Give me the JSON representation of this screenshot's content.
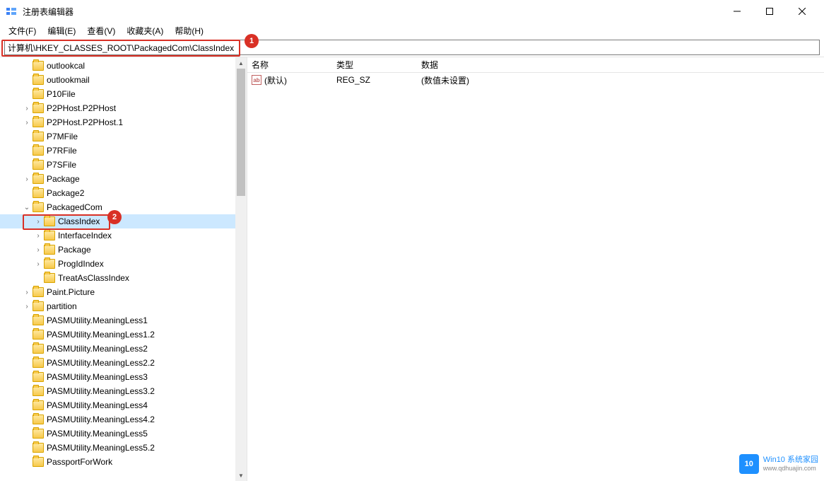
{
  "window": {
    "title": "注册表编辑器"
  },
  "menu": {
    "file": "文件(F)",
    "edit": "编辑(E)",
    "view": "查看(V)",
    "favorites": "收藏夹(A)",
    "help": "帮助(H)"
  },
  "address": "计算机\\HKEY_CLASSES_ROOT\\PackagedCom\\ClassIndex",
  "callouts": {
    "one": "1",
    "two": "2"
  },
  "tree": [
    {
      "indent": 2,
      "expander": "",
      "label": "outlookcal"
    },
    {
      "indent": 2,
      "expander": "",
      "label": "outlookmail"
    },
    {
      "indent": 2,
      "expander": "",
      "label": "P10File"
    },
    {
      "indent": 2,
      "expander": "›",
      "label": "P2PHost.P2PHost"
    },
    {
      "indent": 2,
      "expander": "›",
      "label": "P2PHost.P2PHost.1"
    },
    {
      "indent": 2,
      "expander": "",
      "label": "P7MFile"
    },
    {
      "indent": 2,
      "expander": "",
      "label": "P7RFile"
    },
    {
      "indent": 2,
      "expander": "",
      "label": "P7SFile"
    },
    {
      "indent": 2,
      "expander": "›",
      "label": "Package"
    },
    {
      "indent": 2,
      "expander": "",
      "label": "Package2"
    },
    {
      "indent": 2,
      "expander": "⌄",
      "label": "PackagedCom"
    },
    {
      "indent": 3,
      "expander": "›",
      "label": "ClassIndex",
      "selected": true
    },
    {
      "indent": 3,
      "expander": "›",
      "label": "InterfaceIndex"
    },
    {
      "indent": 3,
      "expander": "›",
      "label": "Package"
    },
    {
      "indent": 3,
      "expander": "›",
      "label": "ProgIdIndex"
    },
    {
      "indent": 3,
      "expander": "",
      "label": "TreatAsClassIndex"
    },
    {
      "indent": 2,
      "expander": "›",
      "label": "Paint.Picture"
    },
    {
      "indent": 2,
      "expander": "›",
      "label": "partition"
    },
    {
      "indent": 2,
      "expander": "",
      "label": "PASMUtility.MeaningLess1"
    },
    {
      "indent": 2,
      "expander": "",
      "label": "PASMUtility.MeaningLess1.2"
    },
    {
      "indent": 2,
      "expander": "",
      "label": "PASMUtility.MeaningLess2"
    },
    {
      "indent": 2,
      "expander": "",
      "label": "PASMUtility.MeaningLess2.2"
    },
    {
      "indent": 2,
      "expander": "",
      "label": "PASMUtility.MeaningLess3"
    },
    {
      "indent": 2,
      "expander": "",
      "label": "PASMUtility.MeaningLess3.2"
    },
    {
      "indent": 2,
      "expander": "",
      "label": "PASMUtility.MeaningLess4"
    },
    {
      "indent": 2,
      "expander": "",
      "label": "PASMUtility.MeaningLess4.2"
    },
    {
      "indent": 2,
      "expander": "",
      "label": "PASMUtility.MeaningLess5"
    },
    {
      "indent": 2,
      "expander": "",
      "label": "PASMUtility.MeaningLess5.2"
    },
    {
      "indent": 2,
      "expander": "",
      "label": "PassportForWork"
    }
  ],
  "values": {
    "headers": {
      "name": "名称",
      "type": "类型",
      "data": "数据"
    },
    "rows": [
      {
        "name": "(默认)",
        "type": "REG_SZ",
        "data": "(数值未设置)"
      }
    ]
  },
  "watermark": {
    "brand": "Win10 系统家园",
    "url": "www.qdhuajin.com",
    "logo": "10"
  }
}
